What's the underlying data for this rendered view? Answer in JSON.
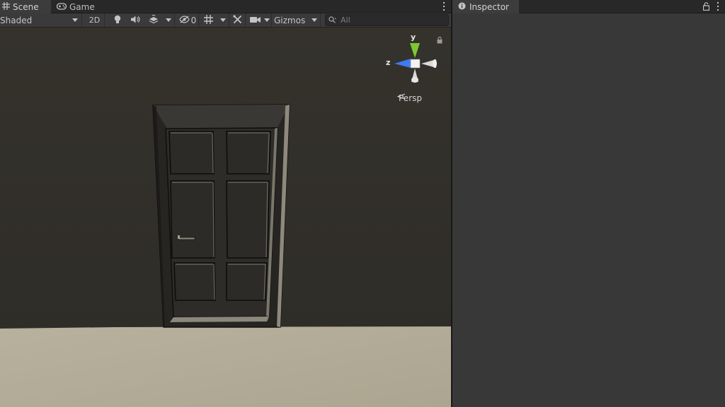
{
  "scene_window": {
    "tabs": [
      {
        "label": "Scene",
        "icon": "grid-icon",
        "active": true
      },
      {
        "label": "Game",
        "icon": "gamepad-icon",
        "active": false
      }
    ],
    "toolbar": {
      "draw_mode": "Shaded",
      "toggle_2d_label": "2D",
      "hidden_count": "0",
      "gizmos_label": "Gizmos",
      "search_placeholder": "All"
    },
    "viewport": {
      "gizmo": {
        "y_label": "y",
        "z_label": "z"
      },
      "projection_label": "Persp",
      "colors": {
        "wall": "#35322c",
        "floor": "#b4ad9a",
        "door": "#2b2a27",
        "frame_edge": "#9c978a",
        "axis_y": "#7ec832",
        "axis_z": "#3f7bf0"
      }
    }
  },
  "inspector_window": {
    "tab_label": "Inspector",
    "icon": "info-icon"
  }
}
